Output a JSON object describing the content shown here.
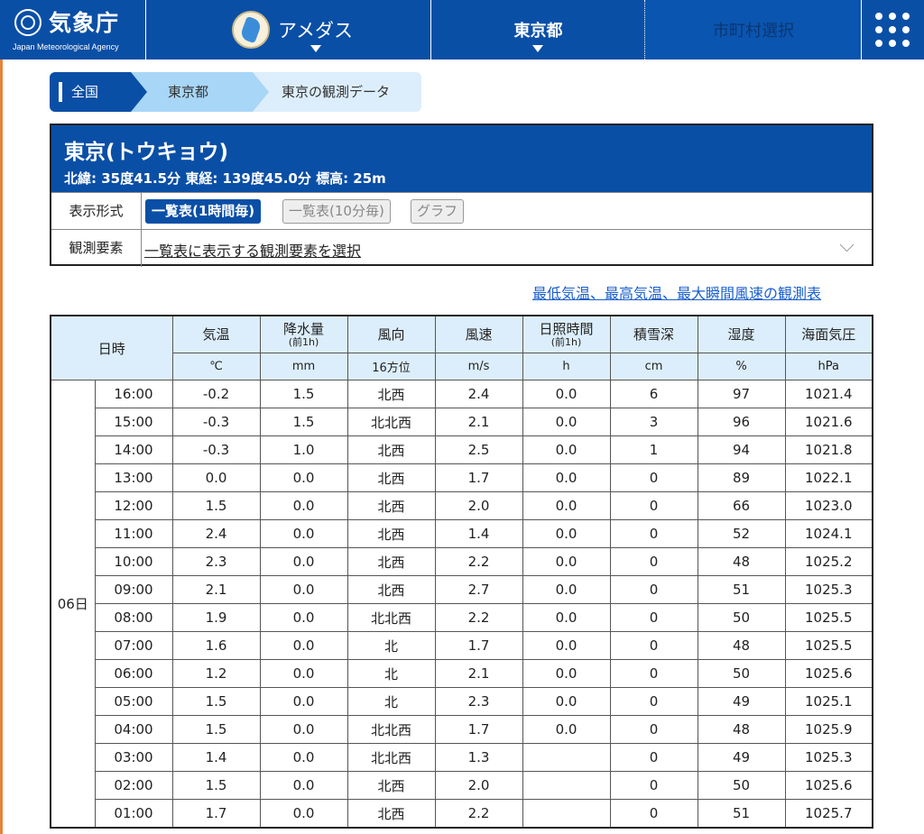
{
  "header": {
    "logo_text": "気象庁",
    "logo_sub": "Japan Meteorological Agency",
    "nav_amedas": "アメダス",
    "nav_pref": "東京都",
    "nav_city": "市町村選択",
    "colors": {
      "brand": "#0a4fa6",
      "accent_light": "#a8d6f7"
    }
  },
  "breadcrumb": {
    "items": [
      "全国",
      "東京都",
      "東京の観測データ"
    ]
  },
  "station": {
    "name": "東京(トウキョウ)",
    "coords": "北緯: 35度41.5分 東経: 139度45.0分 標高: 25m",
    "format_label": "表示形式",
    "format_buttons": [
      "一覧表(1時間毎)",
      "一覧表(10分毎)",
      "グラフ"
    ],
    "elements_label": "観測要素",
    "elements_select": "一覧表に表示する観測要素を選択"
  },
  "extremes_link": "最低気温、最高気温、最大瞬間風速の観測表",
  "table": {
    "date_header": "日時",
    "columns": [
      {
        "name": "気温",
        "sub": "",
        "unit": "℃"
      },
      {
        "name": "降水量",
        "sub": "(前1h)",
        "unit": "mm"
      },
      {
        "name": "風向",
        "sub": "",
        "unit": "16方位"
      },
      {
        "name": "風速",
        "sub": "",
        "unit": "m/s"
      },
      {
        "name": "日照時間",
        "sub": "(前1h)",
        "unit": "h"
      },
      {
        "name": "積雪深",
        "sub": "",
        "unit": "cm"
      },
      {
        "name": "湿度",
        "sub": "",
        "unit": "%"
      },
      {
        "name": "海面気圧",
        "sub": "",
        "unit": "hPa"
      }
    ],
    "day": "06日",
    "rows": [
      [
        "16:00",
        "-0.2",
        "1.5",
        "北西",
        "2.4",
        "0.0",
        "6",
        "97",
        "1021.4"
      ],
      [
        "15:00",
        "-0.3",
        "1.5",
        "北北西",
        "2.1",
        "0.0",
        "3",
        "96",
        "1021.6"
      ],
      [
        "14:00",
        "-0.3",
        "1.0",
        "北西",
        "2.5",
        "0.0",
        "1",
        "94",
        "1021.8"
      ],
      [
        "13:00",
        "0.0",
        "0.0",
        "北西",
        "1.7",
        "0.0",
        "0",
        "89",
        "1022.1"
      ],
      [
        "12:00",
        "1.5",
        "0.0",
        "北西",
        "2.0",
        "0.0",
        "0",
        "66",
        "1023.0"
      ],
      [
        "11:00",
        "2.4",
        "0.0",
        "北西",
        "1.4",
        "0.0",
        "0",
        "52",
        "1024.1"
      ],
      [
        "10:00",
        "2.3",
        "0.0",
        "北西",
        "2.2",
        "0.0",
        "0",
        "48",
        "1025.2"
      ],
      [
        "09:00",
        "2.1",
        "0.0",
        "北西",
        "2.7",
        "0.0",
        "0",
        "51",
        "1025.3"
      ],
      [
        "08:00",
        "1.9",
        "0.0",
        "北北西",
        "2.2",
        "0.0",
        "0",
        "50",
        "1025.5"
      ],
      [
        "07:00",
        "1.6",
        "0.0",
        "北",
        "1.7",
        "0.0",
        "0",
        "48",
        "1025.5"
      ],
      [
        "06:00",
        "1.2",
        "0.0",
        "北",
        "2.1",
        "0.0",
        "0",
        "50",
        "1025.6"
      ],
      [
        "05:00",
        "1.5",
        "0.0",
        "北",
        "2.3",
        "0.0",
        "0",
        "49",
        "1025.1"
      ],
      [
        "04:00",
        "1.5",
        "0.0",
        "北北西",
        "1.7",
        "0.0",
        "0",
        "48",
        "1025.9"
      ],
      [
        "03:00",
        "1.4",
        "0.0",
        "北北西",
        "1.3",
        "",
        "0",
        "49",
        "1025.3"
      ],
      [
        "02:00",
        "1.5",
        "0.0",
        "北西",
        "2.0",
        "",
        "0",
        "50",
        "1025.6"
      ],
      [
        "01:00",
        "1.7",
        "0.0",
        "北西",
        "2.2",
        "",
        "0",
        "51",
        "1025.7"
      ]
    ]
  }
}
